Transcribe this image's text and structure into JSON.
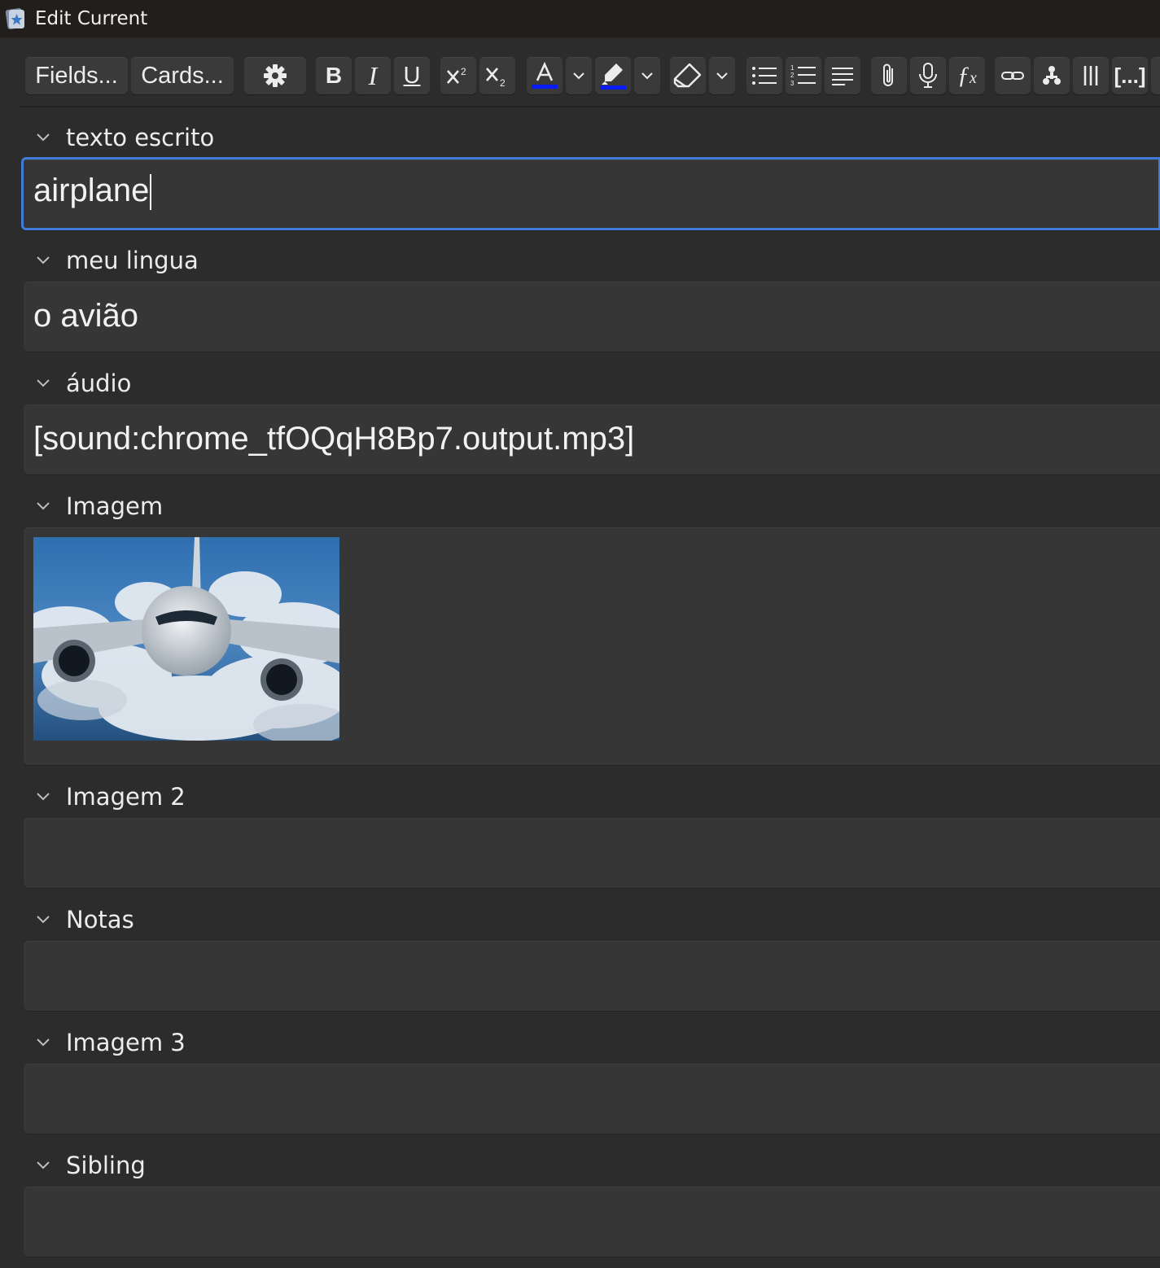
{
  "window": {
    "title": "Edit Current"
  },
  "toolbar": {
    "fields_label": "Fields...",
    "cards_label": "Cards...",
    "icons": [
      "gear-icon",
      "bold-icon",
      "italic-icon",
      "underline-icon",
      "superscript-icon",
      "subscript-icon",
      "text-color-icon",
      "highlight-icon",
      "eraser-icon",
      "bullet-list-icon",
      "numbered-list-icon",
      "align-icon",
      "attach-icon",
      "record-icon",
      "math-icon",
      "link-icon",
      "tree-icon",
      "columns-icon",
      "cloze-icon"
    ],
    "text_color": "#0a1cf5",
    "highlight_color": "#0a1cf5"
  },
  "fields": [
    {
      "label": "texto escrito",
      "value": "airplane",
      "focused": true
    },
    {
      "label": "meu lingua",
      "value": "o avião"
    },
    {
      "label": "áudio",
      "value": "[sound:chrome_tfOQqH8Bp7.output.mp3]"
    },
    {
      "label": "Imagem",
      "value": ""
    },
    {
      "label": "Imagem 2",
      "value": ""
    },
    {
      "label": "Notas",
      "value": ""
    },
    {
      "label": "Imagem 3",
      "value": ""
    },
    {
      "label": "Sibling",
      "value": ""
    }
  ],
  "colors": {
    "background": "#2c2c2c",
    "field": "#363636",
    "focus": "#3f7cd9",
    "titlebar": "#221e1c"
  }
}
